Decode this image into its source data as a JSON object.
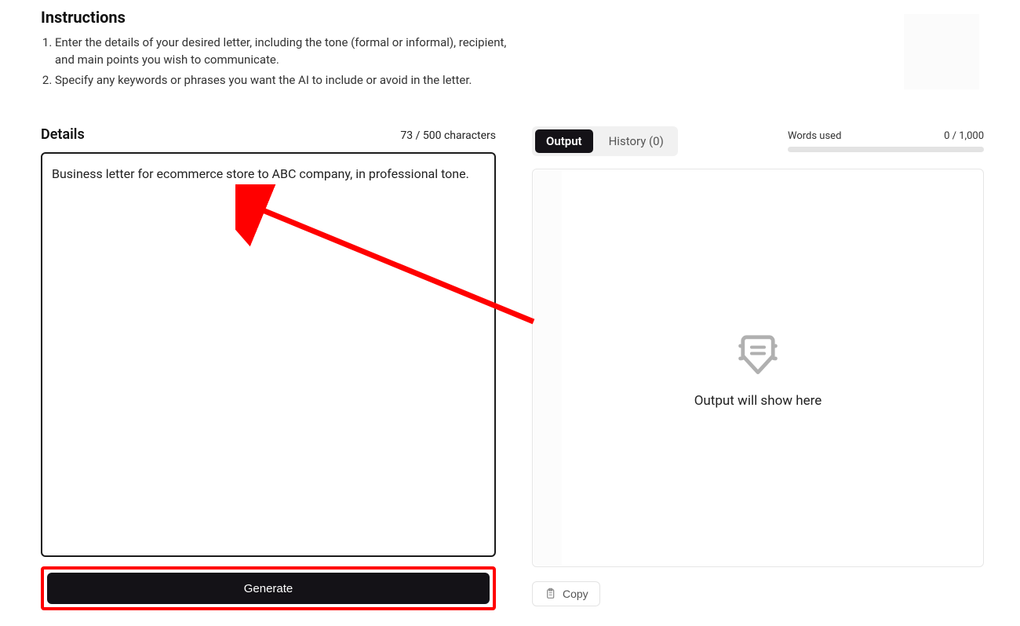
{
  "instructions": {
    "title": "Instructions",
    "items": [
      "Enter the details of your desired letter, including the tone (formal or informal), recipient, and main points you wish to communicate.",
      "Specify any keywords or phrases you want the AI to include or avoid in the letter."
    ]
  },
  "details": {
    "title": "Details",
    "char_count": "73 / 500 characters",
    "value": "Business letter for ecommerce store to ABC company, in professional tone."
  },
  "generate_label": "Generate",
  "tabs": {
    "output": "Output",
    "history": "History (0)"
  },
  "words": {
    "label": "Words used",
    "count": "0 / 1,000"
  },
  "output": {
    "placeholder": "Output will show here"
  },
  "copy_label": "Copy"
}
